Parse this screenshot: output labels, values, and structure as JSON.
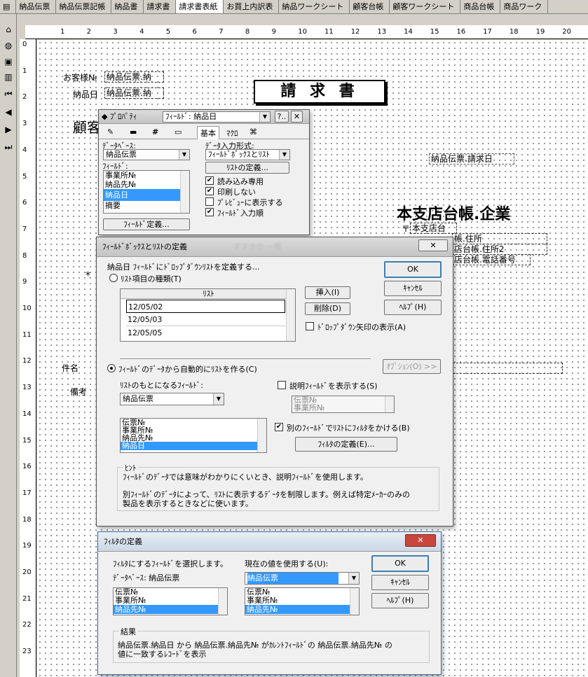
{
  "tabs": [
    "納品伝票",
    "納品伝票記帳",
    "納品書",
    "請求書",
    "請求書表紙",
    "お買上内訳表",
    "納品ワークシート",
    "顧客台帳",
    "顧客ワークシート",
    "商品台帳",
    "商品ワーク"
  ],
  "ruler_h": [
    "1",
    "2",
    "3",
    "4",
    "5",
    "6",
    "7",
    "8",
    "9",
    "10",
    "11",
    "12",
    "13",
    "14",
    "15",
    "16",
    "17",
    "18",
    "19",
    "20"
  ],
  "ruler_v": [
    "0",
    "1",
    "2",
    "3",
    "4",
    "5",
    "6",
    "7",
    "8",
    "9",
    "10",
    "11",
    "12",
    "13",
    "14",
    "15",
    "16",
    "17",
    "18",
    "19",
    "20",
    "21",
    "22",
    "23"
  ],
  "doc": {
    "customer_no_label": "お客様№",
    "customer_no_field": "納品伝票.納",
    "delivery_date_label": "納品日",
    "delivery_date_field": "納品伝票.納",
    "title": "請 求 書",
    "invoice_date_field": "納品伝票.請求日",
    "company": "本支店台帳.企業",
    "postal_mark": "〒",
    "postal_field": "本支店台",
    "address1": "帳.住所",
    "address2": "店台帳.住所2",
    "phone": "店台帳.電話番号",
    "subject_label": "件名",
    "note_label": "備考",
    "stub_kana": "顧客",
    "asterisk": "*"
  },
  "props": {
    "title": "ﾌﾟﾛﾊﾟﾃｨ",
    "field_select": "ﾌｨｰﾙﾄﾞ: 納品日",
    "help_btn": "?..",
    "close_btn": "✕",
    "tabs": [
      "基本",
      "ﾏｸﾛ"
    ],
    "db_label": "ﾃﾞｰﾀﾍﾞｰｽ:",
    "db_value": "納品伝票",
    "input_label": "ﾃﾞｰﾀ入力形式:",
    "input_value": "ﾌｨｰﾙﾄﾞﾎﾞｯｸｽとﾘｽﾄ",
    "field_label": "ﾌｨｰﾙﾄﾞ:",
    "fields": [
      "事業所№",
      "納品先№",
      "納品日",
      "摘要"
    ],
    "list_def_btn": "ﾘｽﾄの定義...",
    "checks": [
      {
        "label": "読み込み専用",
        "checked": true
      },
      {
        "label": "印刷しない",
        "checked": true
      },
      {
        "label": "ﾌﾟﾚﾋﾞｭｰに表示する",
        "checked": false
      },
      {
        "label": "ﾌｨｰﾙﾄﾞ入力順",
        "checked": true
      }
    ],
    "field_def_btn": "ﾌｨｰﾙﾄﾞ定義..."
  },
  "listdef": {
    "title": "ﾌｨｰﾙﾄﾞﾎﾞｯｸｽとﾘｽﾄの定義",
    "title_blurred": "すすきの 一覧",
    "desc": "納品日 ﾌｨｰﾙﾄﾞにﾄﾞﾛｯﾌﾟﾀﾞｳﾝﾘｽﾄを定義する...",
    "radio1": "ﾘｽﾄ項目の種類(T)",
    "list_header": "ﾘｽﾄ",
    "list_items": [
      "12/05/02",
      "12/05/03",
      "12/05/05"
    ],
    "insert_btn": "挿入(I)",
    "delete_btn": "削除(D)",
    "dropdown_check": "ﾄﾞﾛｯﾌﾟﾀﾞｳﾝ矢印の表示(A)",
    "ok": "OK",
    "cancel": "ｷｬﾝｾﾙ",
    "help": "ﾍﾙﾌﾟ(H)",
    "radio2": "ﾌｨｰﾙﾄﾞのﾃﾞｰﾀから自動的にﾘｽﾄを作る(C)",
    "options_btn": "ｵﾌﾟｼｮﾝ(O) >>",
    "source_label": "ﾘｽﾄのもとになるﾌｨｰﾙﾄﾞ:",
    "source_value": "納品伝票",
    "source_fields": [
      "伝票№",
      "事業所№",
      "納品先№",
      "納品日"
    ],
    "desc_check": "説明ﾌｨｰﾙﾄﾞを表示する(S)",
    "desc_fields": [
      "伝票№",
      "事業所№"
    ],
    "filter_check": "別のﾌｨｰﾙﾄﾞでﾘｽﾄにﾌｨﾙﾀをかける(B)",
    "filter_def_btn": "ﾌｨﾙﾀの定義(E)...",
    "hint_title": "ﾋﾝﾄ",
    "hint1": "ﾌｨｰﾙﾄﾞのﾃﾞｰﾀでは意味がわかりにくいとき、説明ﾌｨｰﾙﾄﾞを使用します。",
    "hint2": "別ﾌｨｰﾙﾄﾞのﾃﾞｰﾀによって、ﾘｽﾄに表示するﾃﾞｰﾀを制限します。例えば特定ﾒｰｶｰのみの",
    "hint3": "製品を表示するときなどに使います。",
    "close_glyph": "✕"
  },
  "filterdef": {
    "title": "ﾌｨﾙﾀの定義",
    "close_glyph": "✕",
    "instr": "ﾌｨﾙﾀにするﾌｨｰﾙﾄﾞを選択します。",
    "db_label": "ﾃﾞｰﾀﾍﾞｰｽ: 納品伝票",
    "current_label": "現在の値を使用する(U):",
    "current_value": "納品伝票",
    "left_fields": [
      "伝票№",
      "事業所№",
      "納品先№"
    ],
    "right_fields": [
      "伝票№",
      "事業所№",
      "納品先№"
    ],
    "ok": "OK",
    "cancel": "ｷｬﾝｾﾙ",
    "help": "ﾍﾙﾌﾟ(H)",
    "result_title": "結果",
    "result1": "納品伝票.納品日 から 納品伝票.納品先№ がｶﾚﾝﾄﾌｨｰﾙﾄﾞの 納品伝票.納品先№ の",
    "result2": "値に一致するﾚｺｰﾄﾞを表示"
  }
}
